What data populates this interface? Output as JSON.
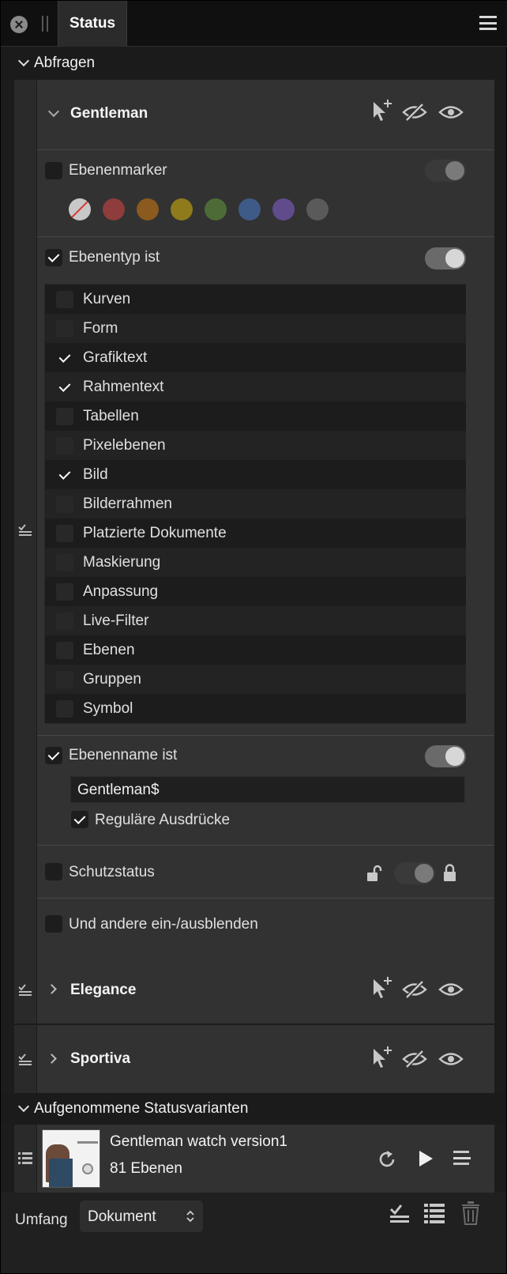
{
  "window": {
    "tab_label": "Status"
  },
  "sections": {
    "queries_label": "Abfragen",
    "captured_label": "Aufgenommene Statusvarianten"
  },
  "query_gentleman": {
    "title": "Gentleman",
    "layer_marker_label": "Ebenenmarker",
    "layer_marker_enabled": false,
    "swatches": [
      "none",
      "#8e3c3c",
      "#8b5a1f",
      "#8f7b1c",
      "#4d6b36",
      "#3e5a87",
      "#604b8c",
      "#5a5a5a"
    ],
    "layer_type_label": "Ebenentyp ist",
    "layer_type_enabled": true,
    "layer_types": [
      {
        "label": "Kurven",
        "checked": false
      },
      {
        "label": "Form",
        "checked": false
      },
      {
        "label": "Grafiktext",
        "checked": true
      },
      {
        "label": "Rahmentext",
        "checked": true
      },
      {
        "label": "Tabellen",
        "checked": false
      },
      {
        "label": "Pixelebenen",
        "checked": false
      },
      {
        "label": "Bild",
        "checked": true
      },
      {
        "label": "Bilderrahmen",
        "checked": false
      },
      {
        "label": "Platzierte Dokumente",
        "checked": false
      },
      {
        "label": "Maskierung",
        "checked": false
      },
      {
        "label": "Anpassung",
        "checked": false
      },
      {
        "label": "Live-Filter",
        "checked": false
      },
      {
        "label": "Ebenen",
        "checked": false
      },
      {
        "label": "Gruppen",
        "checked": false
      },
      {
        "label": "Symbol",
        "checked": false
      }
    ],
    "layer_name_label": "Ebenenname ist",
    "layer_name_enabled": true,
    "layer_name_value": "Gentleman$",
    "regex_label": "Reguläre Ausdrücke",
    "regex_checked": true,
    "lock_status_label": "Schutzstatus",
    "others_label": "Und andere ein-/ausblenden"
  },
  "query_elegance": {
    "title": "Elegance"
  },
  "query_sportiva": {
    "title": "Sportiva"
  },
  "captured_state": {
    "name": "Gentleman watch version1",
    "layers": "81 Ebenen"
  },
  "footer": {
    "scope_label": "Umfang",
    "scope_value": "Dokument"
  }
}
